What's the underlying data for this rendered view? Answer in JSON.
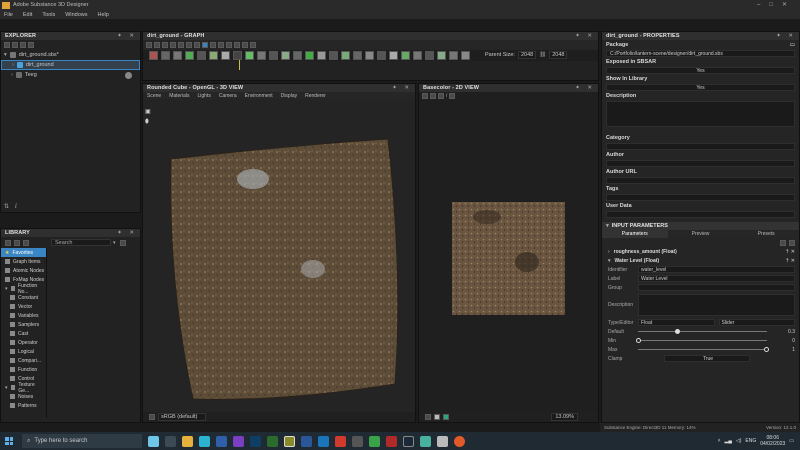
{
  "window": {
    "title": "Adobe Substance 3D Designer"
  },
  "menu": [
    "File",
    "Edit",
    "Tools",
    "Windows",
    "Help"
  ],
  "explorer": {
    "title": "EXPLORER",
    "file": "dirt_ground.sbs*",
    "graph": "dirt_ground",
    "resources": "Teeg"
  },
  "library": {
    "title": "LIBRARY",
    "search_placeholder": "Search",
    "categories": [
      "Favorites",
      "Graph Items",
      "Atomic Nodes",
      "FxMap Nodes",
      "Function No...",
      "Constant",
      "Vector",
      "Variables",
      "Samplers",
      "Cast",
      "Operator",
      "Logical",
      "Compari...",
      "Function",
      "Control",
      "Texture Ge...",
      "Noises",
      "Patterns"
    ]
  },
  "graph": {
    "title": "dirt_ground - GRAPH",
    "parent_size_label": "Parent Size:",
    "parent_size_w": "2048",
    "parent_size_h": "2048"
  },
  "view3d": {
    "title": "Rounded Cube - OpenGL - 3D VIEW",
    "menu": [
      "Scene",
      "Materials",
      "Lights",
      "Camera",
      "Environment",
      "Display",
      "Renderer"
    ],
    "colorspace": "sRGB (default)"
  },
  "view2d": {
    "title": "Basecolor - 2D VIEW",
    "zoom": "13.09%"
  },
  "properties": {
    "title": "dirt_ground - PROPERTIES",
    "package_label": "Package",
    "package_value": "C:/Portfolio/lantern-scene/designer/dirt_ground.sbs",
    "exposed_label": "Exposed in SBSAR",
    "exposed_value": "Yes",
    "show_library_label": "Show In Library",
    "show_library_value": "Yes",
    "description_label": "Description",
    "category_label": "Category",
    "author_label": "Author",
    "author_url_label": "Author URL",
    "tags_label": "Tags",
    "user_data_label": "User Data",
    "input_params_title": "INPUT PARAMETERS",
    "tabs": [
      "Parameters",
      "Preview",
      "Presets"
    ],
    "param1": "roughness_amount (Float)",
    "param2": "Water Level (Float)",
    "identifier_label": "Identifier",
    "identifier_value": "water_level",
    "label_label": "Label",
    "label_value": "Water Level",
    "group_label": "Group",
    "description2_label": "Description",
    "type_label": "Type/Editor",
    "type_value": "Float",
    "editor_value": "Slider",
    "default_label": "Default",
    "default_value": "0.3",
    "default_fraction": 0.3,
    "min_label": "Min",
    "min_value": "0",
    "max_label": "Max",
    "max_value": "1",
    "clamp_label": "Clamp",
    "clamp_value": "True"
  },
  "status": {
    "engine": "Substance Engine: Direct3D 11  Memory: 14%",
    "version": "Version: 12.1.0"
  },
  "taskbar": {
    "search_placeholder": "Type here to search",
    "lang": "ENG",
    "time": "08:06",
    "date": "04/02/2023"
  }
}
